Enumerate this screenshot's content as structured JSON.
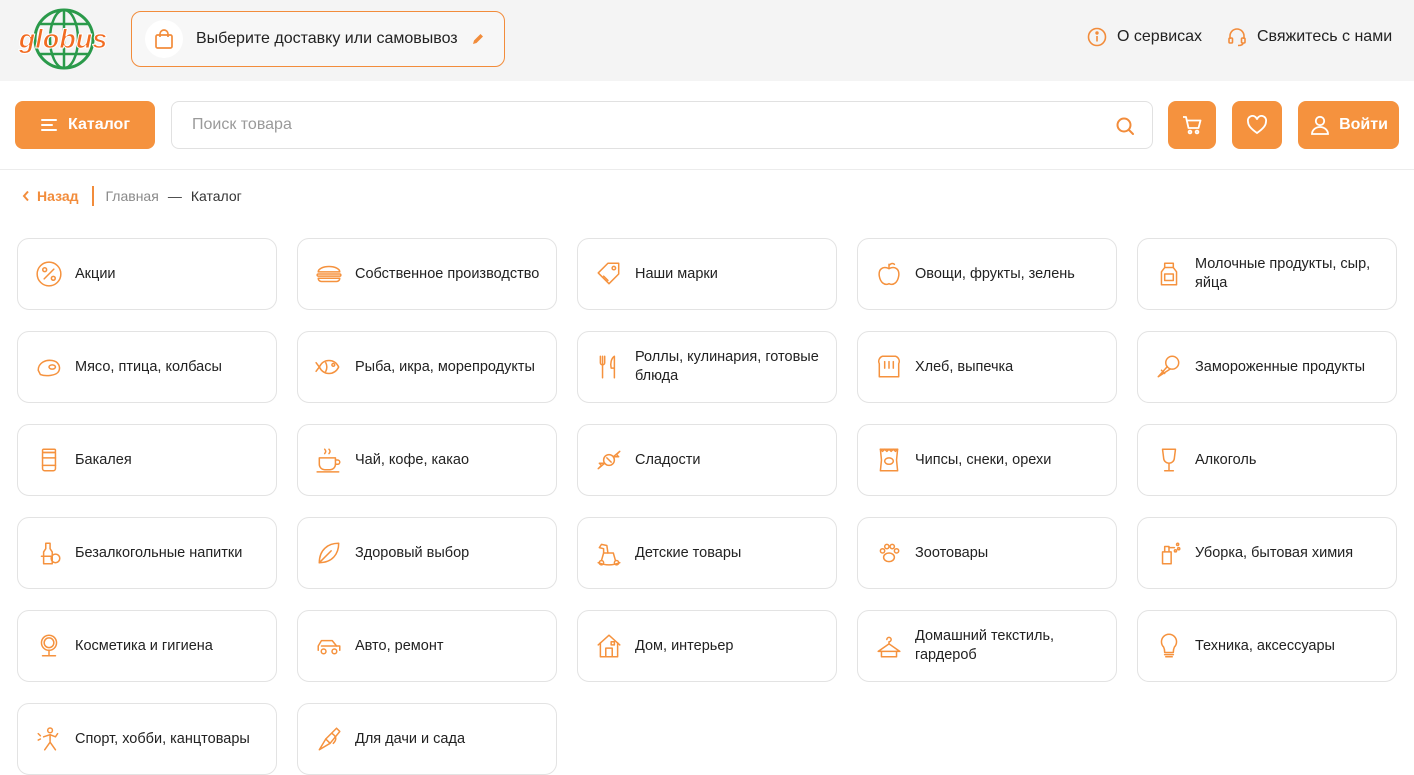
{
  "colors": {
    "accent": "#f5923e",
    "logo_green": "#2a9a4a",
    "logo_orange": "#f26b21"
  },
  "header": {
    "logo_text": "globus",
    "delivery_label": "Выберите доставку или самовывоз",
    "services_label": "О сервисах",
    "contact_label": "Свяжитесь с нами"
  },
  "toolbar": {
    "catalog_label": "Каталог",
    "search_placeholder": "Поиск товара",
    "login_label": "Войти"
  },
  "breadcrumb": {
    "back_label": "Назад",
    "home_label": "Главная",
    "separator": "—",
    "current_label": "Каталог"
  },
  "categories": [
    {
      "label": "Акции",
      "icon": "percent-icon"
    },
    {
      "label": "Собственное производство",
      "icon": "burger-icon"
    },
    {
      "label": "Наши марки",
      "icon": "tag-icon"
    },
    {
      "label": "Овощи, фрукты, зелень",
      "icon": "apple-icon"
    },
    {
      "label": "Молочные продукты, сыр, яйца",
      "icon": "milk-icon"
    },
    {
      "label": "Мясо, птица, колбасы",
      "icon": "meat-icon"
    },
    {
      "label": "Рыба, икра, морепродукты",
      "icon": "fish-icon"
    },
    {
      "label": "Роллы, кулинария, готовые блюда",
      "icon": "cutlery-icon"
    },
    {
      "label": "Хлеб, выпечка",
      "icon": "bread-icon"
    },
    {
      "label": "Замороженные продукты",
      "icon": "ice-cream-icon"
    },
    {
      "label": "Бакалея",
      "icon": "jar-icon"
    },
    {
      "label": "Чай, кофе, какао",
      "icon": "cup-icon"
    },
    {
      "label": "Сладости",
      "icon": "candy-icon"
    },
    {
      "label": "Чипсы, снеки, орехи",
      "icon": "chips-icon"
    },
    {
      "label": "Алкоголь",
      "icon": "wine-glass-icon"
    },
    {
      "label": "Безалкогольные напитки",
      "icon": "drinks-icon"
    },
    {
      "label": "Здоровый выбор",
      "icon": "leaf-icon"
    },
    {
      "label": "Детские товары",
      "icon": "rocking-horse-icon"
    },
    {
      "label": "Зоотовары",
      "icon": "paw-icon"
    },
    {
      "label": "Уборка, бытовая химия",
      "icon": "spray-icon"
    },
    {
      "label": "Косметика и гигиена",
      "icon": "mirror-icon"
    },
    {
      "label": "Авто, ремонт",
      "icon": "car-icon"
    },
    {
      "label": "Дом, интерьер",
      "icon": "house-icon"
    },
    {
      "label": "Домашний текстиль, гардероб",
      "icon": "hanger-icon"
    },
    {
      "label": "Техника, аксессуары",
      "icon": "lightbulb-icon"
    },
    {
      "label": "Спорт, хобби, канцтовары",
      "icon": "sport-icon"
    },
    {
      "label": "Для дачи и сада",
      "icon": "garden-icon"
    }
  ]
}
